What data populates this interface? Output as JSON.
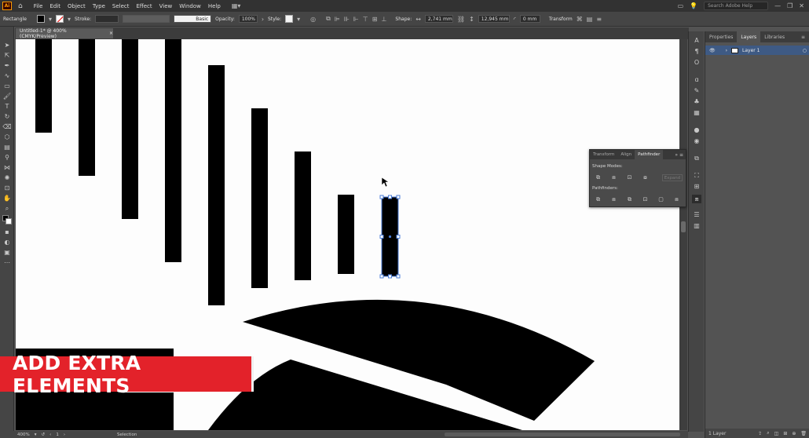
{
  "app": {
    "logo": "Ai",
    "menus": [
      "File",
      "Edit",
      "Object",
      "Type",
      "Select",
      "Effect",
      "View",
      "Window",
      "Help"
    ],
    "search_placeholder": "Search Adobe Help",
    "window_controls": [
      "—",
      "❐",
      "✕"
    ]
  },
  "control_bar": {
    "tool_name": "Rectangle",
    "stroke_label": "Stroke:",
    "brush_label": "Basic",
    "opacity_label": "Opacity:",
    "opacity_value": "100%",
    "style_label": "Style:",
    "shape_label": "Shape:",
    "width_value": "2,741 mm",
    "height_value": "12,945 mm",
    "corner_value": "0 mm",
    "transform_label": "Transform",
    "accent_color": "#454545"
  },
  "document": {
    "tab_title": "Untitled-1* @ 400% (CMYK/Preview)",
    "tab_close": "×",
    "canvas_color": "#fdfdfd",
    "art_color": "#000000",
    "selection_color": "#4a7cd6"
  },
  "panels": {
    "layers_tabs": [
      "Properties",
      "Layers",
      "Libraries"
    ],
    "active_layers_tab": "Layers",
    "layer_name": "Layer 1",
    "layers_footer": "1 Layer",
    "layer_row_color": "#3e5a84"
  },
  "pathfinder": {
    "tabs": [
      "Transform",
      "Align",
      "Pathfinder"
    ],
    "active_tab": "Pathfinder",
    "shape_modes_label": "Shape Modes:",
    "pathfinders_label": "Pathfinders:",
    "expand_label": "Expand"
  },
  "status_bar": {
    "zoom": "400%",
    "artboard": "1",
    "tool": "Selection"
  },
  "overlay": {
    "banner_text": "ADD EXTRA ELEMENTS",
    "banner_color": "#e3222a"
  }
}
